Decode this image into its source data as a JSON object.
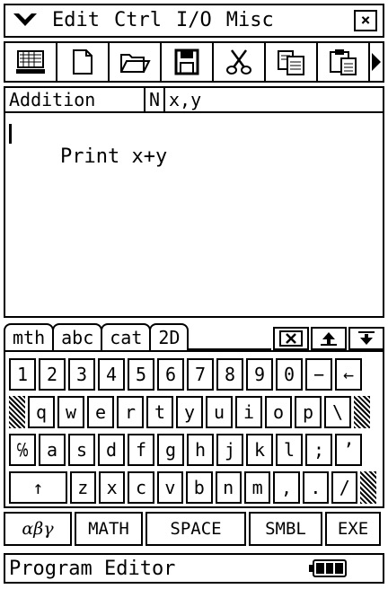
{
  "menu": {
    "items": [
      "Edit",
      "Ctrl",
      "I/O",
      "Misc"
    ],
    "close_label": "×"
  },
  "toolbar": {
    "buttons": [
      "run-icon",
      "new-file-icon",
      "open-folder-icon",
      "save-icon",
      "cut-icon",
      "copy-icon",
      "paste-icon",
      "more-arrow-icon"
    ]
  },
  "program": {
    "name": "Addition",
    "type": "N",
    "params": "x,y",
    "lines": [
      "Print x+y"
    ]
  },
  "keyboard": {
    "tabs": [
      "mth",
      "abc",
      "cat",
      "2D"
    ],
    "active_tab": "abc",
    "row1": [
      "1",
      "2",
      "3",
      "4",
      "5",
      "6",
      "7",
      "8",
      "9",
      "0",
      "−",
      "←"
    ],
    "row2": [
      "q",
      "w",
      "e",
      "r",
      "t",
      "y",
      "u",
      "i",
      "o",
      "p",
      "\\"
    ],
    "row3": [
      "℅",
      "a",
      "s",
      "d",
      "f",
      "g",
      "h",
      "j",
      "k",
      "l",
      ";",
      "’"
    ],
    "row4": [
      "↑",
      "z",
      "x",
      "c",
      "v",
      "b",
      "n",
      "m",
      ",",
      ".",
      "/"
    ],
    "function_keys": [
      "αβγ",
      "MATH",
      "SPACE",
      "SMBL",
      "EXE"
    ]
  },
  "status": {
    "mode": "Program Editor"
  }
}
